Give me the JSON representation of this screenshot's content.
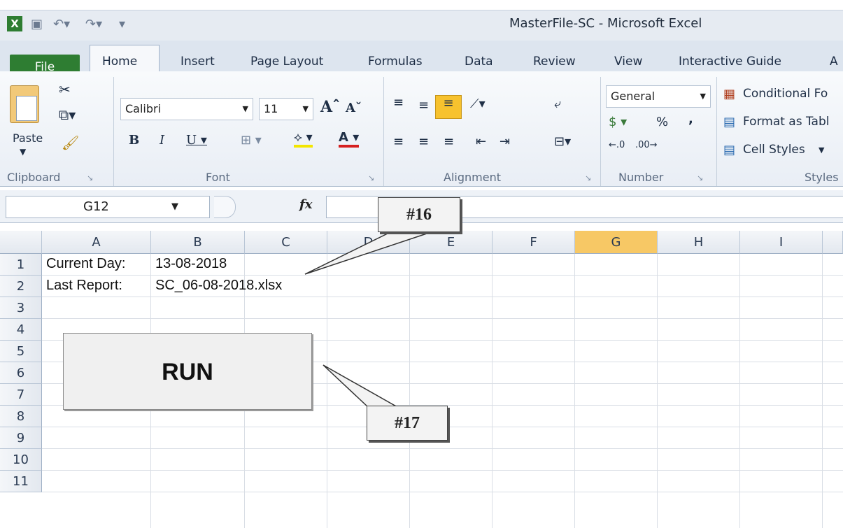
{
  "window": {
    "title": "MasterFile-SC - Microsoft Excel"
  },
  "tabs": [
    {
      "label": "File"
    },
    {
      "label": "Home"
    },
    {
      "label": "Insert"
    },
    {
      "label": "Page Layout"
    },
    {
      "label": "Formulas"
    },
    {
      "label": "Data"
    },
    {
      "label": "Review"
    },
    {
      "label": "View"
    },
    {
      "label": "Interactive Guide"
    },
    {
      "label": "A"
    }
  ],
  "ribbon": {
    "clipboard": {
      "paste_label": "Paste",
      "group_label": "Clipboard"
    },
    "font": {
      "name": "Calibri",
      "size": "11",
      "group_label": "Font"
    },
    "alignment": {
      "group_label": "Alignment"
    },
    "number": {
      "format": "General",
      "percent": "%",
      "comma": ",",
      "group_label": "Number"
    },
    "styles": {
      "conditional": "Conditional Fo",
      "format_table": "Format as Tabl",
      "cell_styles": "Cell Styles",
      "group_label": "Styles"
    }
  },
  "formula_bar": {
    "name_box": "G12",
    "fx": "fx",
    "value": ""
  },
  "grid": {
    "columns": [
      "A",
      "B",
      "C",
      "D",
      "E",
      "F",
      "G",
      "H",
      "I"
    ],
    "rows": [
      "1",
      "2",
      "3",
      "4",
      "5",
      "6",
      "7",
      "8",
      "9",
      "10",
      "11"
    ],
    "cells": {
      "a1": "Current Day:",
      "b1": "13-08-2018",
      "a2": "Last Report:",
      "b2": "SC_06-08-2018.xlsx"
    },
    "selected_column": "G"
  },
  "run_button": {
    "label": "RUN"
  },
  "callouts": {
    "c16": "#16",
    "c17": "#17"
  },
  "colors": {
    "file_tab": "#2e7d32",
    "selected_header": "#f7c865",
    "highlight_button": "#f7c22e"
  }
}
